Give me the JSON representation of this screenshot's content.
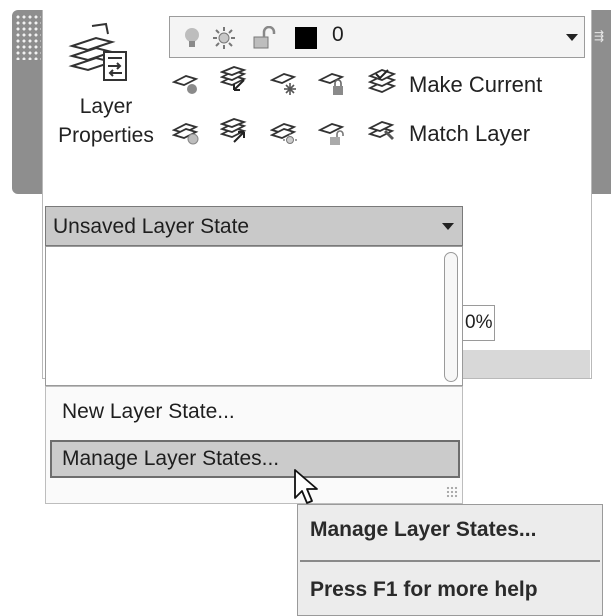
{
  "ribbon": {
    "layer_properties": {
      "label_line1": "Layer",
      "label_line2": "Properties",
      "icon": "layer-properties-icon"
    },
    "layer_combo": {
      "icons": [
        "light-bulb-icon",
        "sun-icon",
        "unlock-icon"
      ],
      "color_swatch": "#000000",
      "value": "0"
    },
    "tools_row1": {
      "icons": [
        "layer-off-icon",
        "isolate-layer-icon",
        "freeze-layer-icon",
        "lock-layer-icon",
        "make-current-icon"
      ],
      "label": "Make Current"
    },
    "tools_row2": {
      "icons": [
        "layer-on-icon",
        "unisolate-layer-icon",
        "thaw-layer-icon",
        "unlock-layer-icon",
        "match-layer-icon"
      ],
      "label": "Match Layer"
    },
    "partial_field": "0%"
  },
  "layer_state": {
    "selected": "Unsaved Layer State",
    "menu_items": [
      "New Layer State...",
      "Manage Layer States..."
    ]
  },
  "tooltip": {
    "title": "Manage Layer States...",
    "help": "Press F1 for more help"
  }
}
